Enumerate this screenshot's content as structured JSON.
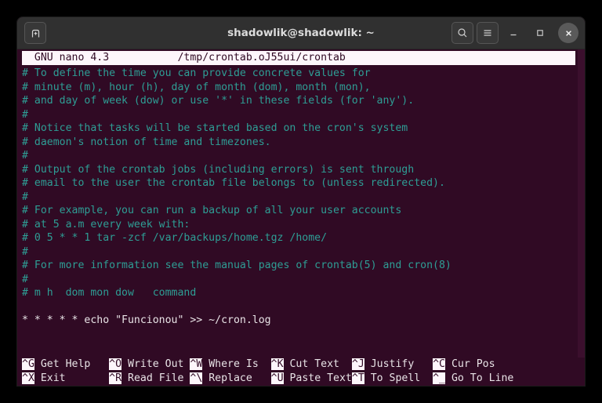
{
  "window": {
    "title": "shadowlik@shadowlik: ~",
    "new_tab_icon": "new-tab-icon",
    "search_icon": "search-icon",
    "menu_icon": "hamburger-menu-icon",
    "minimize_label": "–",
    "maximize_label": "□",
    "close_label": "✕",
    "colors": {
      "titlebar_bg": "#303030",
      "terminal_bg": "#300a24",
      "comment_fg": "#2e9e95",
      "text_fg": "#e8e3e6",
      "inverse_bg": "#fdf6fb"
    }
  },
  "nano": {
    "version_label": "  GNU nano 4.3",
    "filename": "/tmp/crontab.oJ55ui/crontab",
    "header_line": "  GNU nano 4.3           /tmp/crontab.oJ55ui/crontab",
    "lines": [
      {
        "text": "# To define the time you can provide concrete values for",
        "type": "comment"
      },
      {
        "text": "# minute (m), hour (h), day of month (dom), month (mon),",
        "type": "comment"
      },
      {
        "text": "# and day of week (dow) or use '*' in these fields (for 'any').",
        "type": "comment"
      },
      {
        "text": "#",
        "type": "comment"
      },
      {
        "text": "# Notice that tasks will be started based on the cron's system",
        "type": "comment"
      },
      {
        "text": "# daemon's notion of time and timezones.",
        "type": "comment"
      },
      {
        "text": "#",
        "type": "comment"
      },
      {
        "text": "# Output of the crontab jobs (including errors) is sent through",
        "type": "comment"
      },
      {
        "text": "# email to the user the crontab file belongs to (unless redirected).",
        "type": "comment"
      },
      {
        "text": "#",
        "type": "comment"
      },
      {
        "text": "# For example, you can run a backup of all your user accounts",
        "type": "comment"
      },
      {
        "text": "# at 5 a.m every week with:",
        "type": "comment"
      },
      {
        "text": "# 0 5 * * 1 tar -zcf /var/backups/home.tgz /home/",
        "type": "comment"
      },
      {
        "text": "#",
        "type": "comment"
      },
      {
        "text": "# For more information see the manual pages of crontab(5) and cron(8)",
        "type": "comment"
      },
      {
        "text": "#",
        "type": "comment"
      },
      {
        "text": "# m h  dom mon dow   command",
        "type": "comment"
      },
      {
        "text": "",
        "type": "blank"
      },
      {
        "text": "* * * * * echo \"Funcionou\" >> ~/cron.log",
        "type": "code"
      }
    ]
  },
  "shortcuts": {
    "row1": [
      {
        "key": "^G",
        "label": " Get Help   "
      },
      {
        "key": "^O",
        "label": " Write Out "
      },
      {
        "key": "^W",
        "label": " Where Is  "
      },
      {
        "key": "^K",
        "label": " Cut Text  "
      },
      {
        "key": "^J",
        "label": " Justify   "
      },
      {
        "key": "^C",
        "label": " Cur Pos"
      }
    ],
    "row2": [
      {
        "key": "^X",
        "label": " Exit       "
      },
      {
        "key": "^R",
        "label": " Read File "
      },
      {
        "key": "^\\",
        "label": " Replace   "
      },
      {
        "key": "^U",
        "label": " Paste Text"
      },
      {
        "key": "^T",
        "label": " To Spell  "
      },
      {
        "key": "^_",
        "label": " Go To Line"
      }
    ]
  }
}
